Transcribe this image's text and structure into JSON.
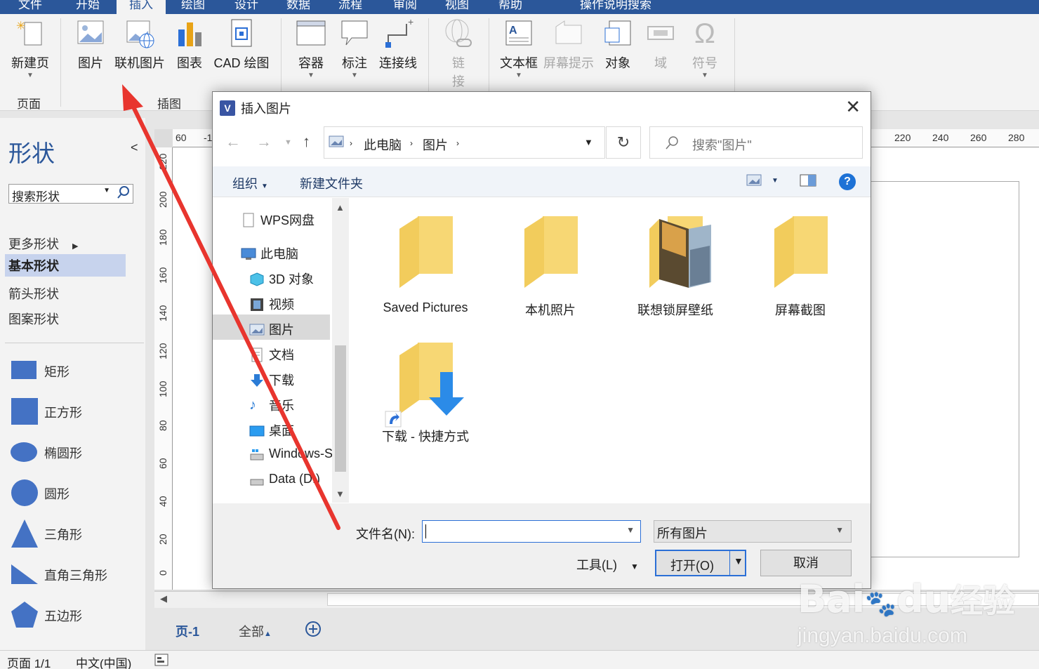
{
  "tabs": [
    "文件",
    "开始",
    "插入",
    "绘图",
    "设计",
    "数据",
    "流程",
    "审阅",
    "视图",
    "帮助",
    "操作说明搜索"
  ],
  "ribbon": {
    "new_page": "新建页",
    "picture": "图片",
    "online_picture": "联机图片",
    "chart": "图表",
    "cad": "CAD 绘图",
    "container": "容器",
    "callout": "标注",
    "connector": "连接线",
    "link": "链\n接",
    "link_1": "链",
    "link_2": "接",
    "textbox": "文本框",
    "screentip": "屏幕提示",
    "object": "对象",
    "field": "域",
    "symbol": "符号",
    "group_pages": "页面",
    "group_illustrations": "插图"
  },
  "shapes": {
    "title": "形状",
    "collapse": "<",
    "search_placeholder": "搜索形状",
    "stencils": [
      "更多形状",
      "基本形状",
      "箭头形状",
      "图案形状"
    ],
    "items": [
      "矩形",
      "正方形",
      "椭圆形",
      "圆形",
      "三角形",
      "直角三角形",
      "五边形"
    ]
  },
  "ruler": {
    "h": [
      "60",
      "-1",
      "220",
      "240",
      "260",
      "280"
    ],
    "v": [
      "220",
      "200",
      "180",
      "160",
      "140",
      "120",
      "100",
      "80",
      "60",
      "40",
      "20",
      "0"
    ]
  },
  "page_tabs": {
    "page": "页-1",
    "all": "全部"
  },
  "status": {
    "page": "页面 1/1",
    "lang": "中文(中国)"
  },
  "dialog": {
    "title": "插入图片",
    "path": [
      "此电脑",
      "图片"
    ],
    "search_placeholder": "搜索\"图片\"",
    "organize": "组织",
    "new_folder": "新建文件夹",
    "nav": [
      "WPS网盘",
      "此电脑",
      "3D 对象",
      "视频",
      "图片",
      "文档",
      "下载",
      "音乐",
      "桌面",
      "Windows-S",
      "Data (D:)"
    ],
    "files": [
      "Saved Pictures",
      "本机照片",
      "联想锁屏壁纸",
      "屏幕截图",
      "下载 - 快捷方式"
    ],
    "filename_label": "文件名(N):",
    "filename_value": "",
    "filetype": "所有图片",
    "tools": "工具(L)",
    "open": "打开(O)",
    "cancel": "取消"
  },
  "watermark": {
    "line1": "Bai",
    "line1b": "du",
    "line1c": "经验",
    "line2": "jingyan.baidu.com"
  },
  "colors": {
    "accent": "#2b579a",
    "annotation": "#e8352e",
    "folder": "#f7d774"
  }
}
